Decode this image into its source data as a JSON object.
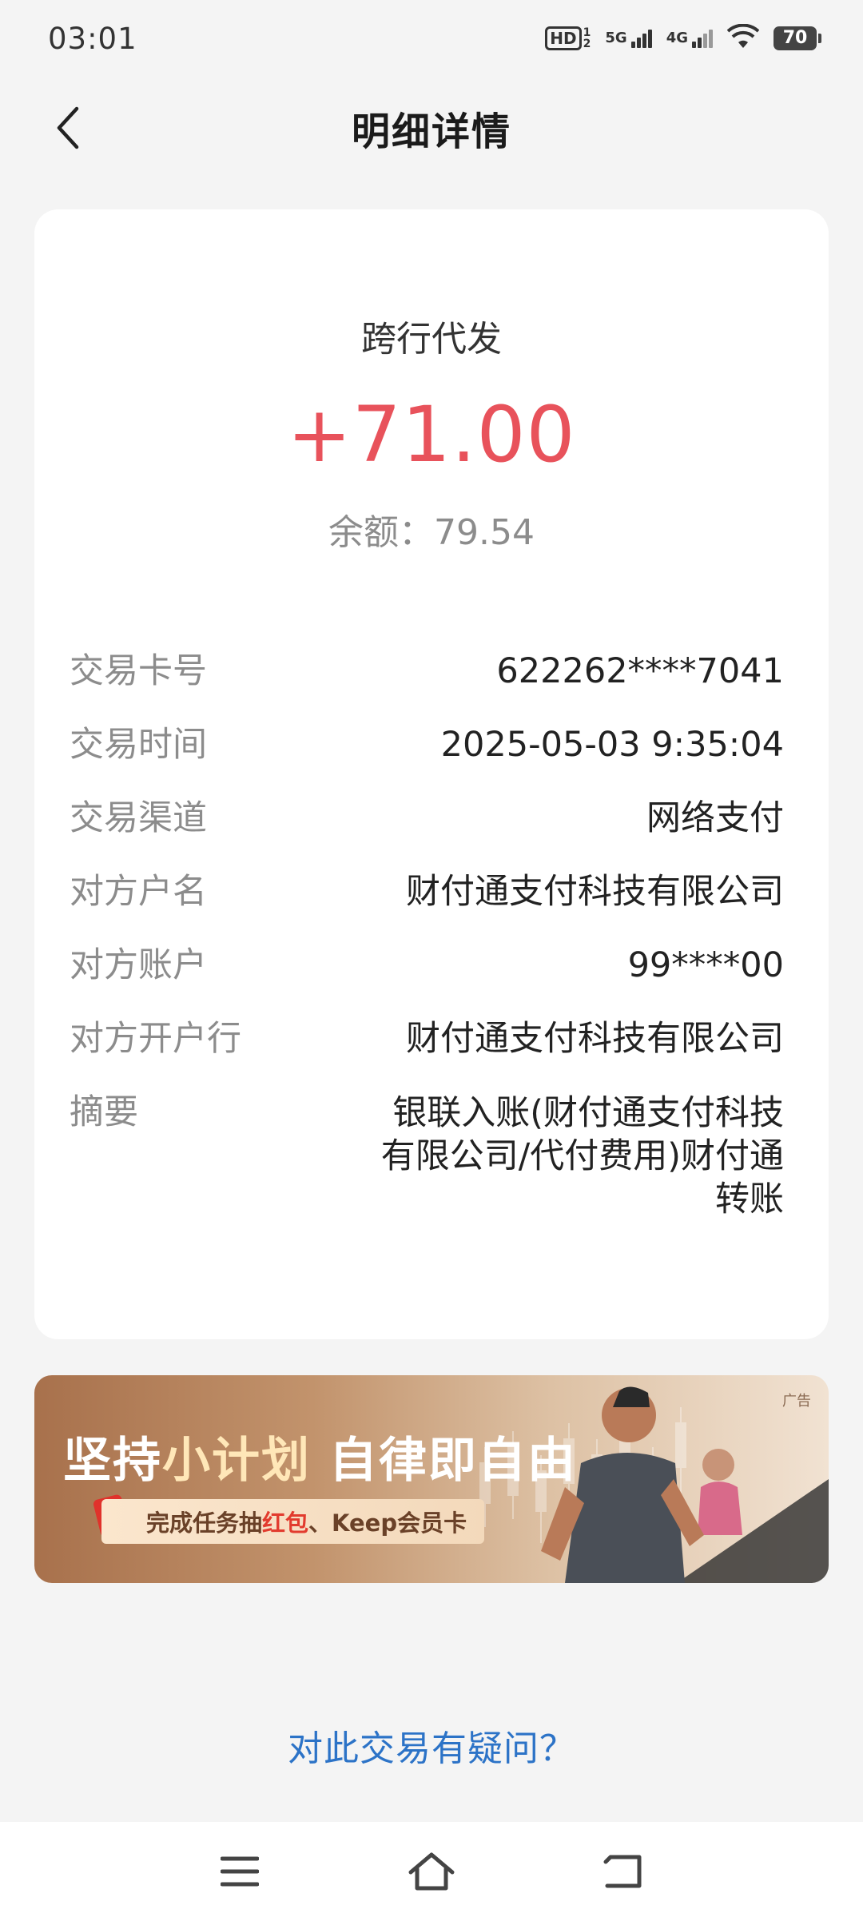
{
  "status_bar": {
    "time": "03:01",
    "network_1": "5G",
    "network_2": "4G",
    "battery": "70",
    "icons": [
      "hd-icon",
      "signal-icon",
      "wifi-icon",
      "battery-icon"
    ]
  },
  "header": {
    "title": "明细详情",
    "back_icon": "chevron-left-icon"
  },
  "transaction": {
    "type": "跨行代发",
    "amount": "+71.00",
    "balance": "余额：79.54",
    "amount_color": "#e8525b"
  },
  "details": [
    {
      "label": "交易卡号",
      "value": "622262****7041"
    },
    {
      "label": "交易时间",
      "value": "2025-05-03 9:35:04"
    },
    {
      "label": "交易渠道",
      "value": "网络支付"
    },
    {
      "label": "对方户名",
      "value": "财付通支付科技有限公司"
    },
    {
      "label": "对方账户",
      "value": "99****00"
    },
    {
      "label": "对方开户行",
      "value": "财付通支付科技有限公司"
    },
    {
      "label": "摘要",
      "value": "银联入账(财付通支付科技有限公司/代付费用)财付通转账"
    }
  ],
  "ad": {
    "tag": "广告",
    "title_part1": "坚持",
    "title_highlight": "小计划",
    "title_part2": " 自律即自由",
    "pill_part1": "完成任务抽",
    "pill_highlight": "红包",
    "pill_part2": "、Keep会员卡"
  },
  "question_link": "对此交易有疑问？",
  "nav": {
    "menu_icon": "menu-icon",
    "home_icon": "home-icon",
    "back_icon": "back-icon"
  },
  "colors": {
    "background": "#f4f4f4",
    "link": "#2c73c7",
    "label": "#8c8c8c"
  }
}
